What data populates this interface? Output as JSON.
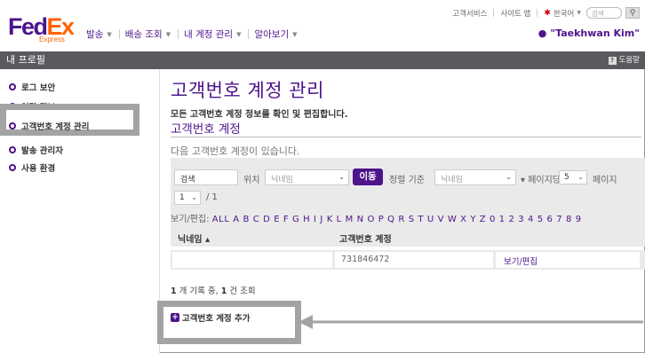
{
  "logo": {
    "fed": "Fed",
    "ex": "Ex",
    "sub": "Express"
  },
  "topnav": {
    "items": [
      {
        "label": "발송"
      },
      {
        "label": "배송 조회"
      },
      {
        "label": "내 계정 관리"
      },
      {
        "label": "알아보기"
      }
    ]
  },
  "util": {
    "customer_service": "고객서비스",
    "site_map": "사이트 맵",
    "language": "한국어",
    "search_placeholder": "검색"
  },
  "user": {
    "name": "\"Taekhwan Kim\""
  },
  "titlebar": {
    "title": "내 프로필",
    "help": "도움말"
  },
  "sidebar": {
    "items": [
      {
        "label": "로그 보안"
      },
      {
        "label": "연락 정보"
      },
      {
        "label": "고객번호 계정 관리"
      },
      {
        "label": "발송 관리자"
      },
      {
        "label": "사용 환경"
      }
    ]
  },
  "main": {
    "title": "고객번호 계정 관리",
    "description": "모든 고객번호 계정 정보를 확인 및 편집합니다.",
    "subtitle": "고객번호 계정",
    "count_text": "다음 고객번호 계정이 있습니다.",
    "filter": {
      "search_value": "검색",
      "position_label": "위치",
      "position_value": "닉네임",
      "go_label": "이동",
      "sort_label": "정렬 기준",
      "sort_value": "닉네임",
      "per_page_label": "페이지당",
      "per_page_value": "5",
      "page_label": "페이지",
      "page_value": "1",
      "page_total": "/ 1"
    },
    "alpha": {
      "label": "보기/편집:",
      "letters": "ALL A B C D E F G H I J K L M N O P Q R S T U V W X Y Z 0 1 2 3 4 5 6 7 8 9"
    },
    "table": {
      "headers": [
        "닉네임 ▴",
        "고객번호 계정"
      ],
      "rows": [
        {
          "nickname": "",
          "account": "731846472",
          "action": "보기/편집"
        }
      ]
    },
    "result": {
      "count": "1",
      "count_suffix": " 개 기록 중, ",
      "shown": "1",
      "shown_suffix": " 건 조회"
    },
    "add_label": "고객번호 계정 추가"
  },
  "colors": {
    "brand_purple": "#4d148c",
    "brand_orange": "#ff6200",
    "titlebar": "#585a5e",
    "highlight": "#a3a3a3"
  }
}
